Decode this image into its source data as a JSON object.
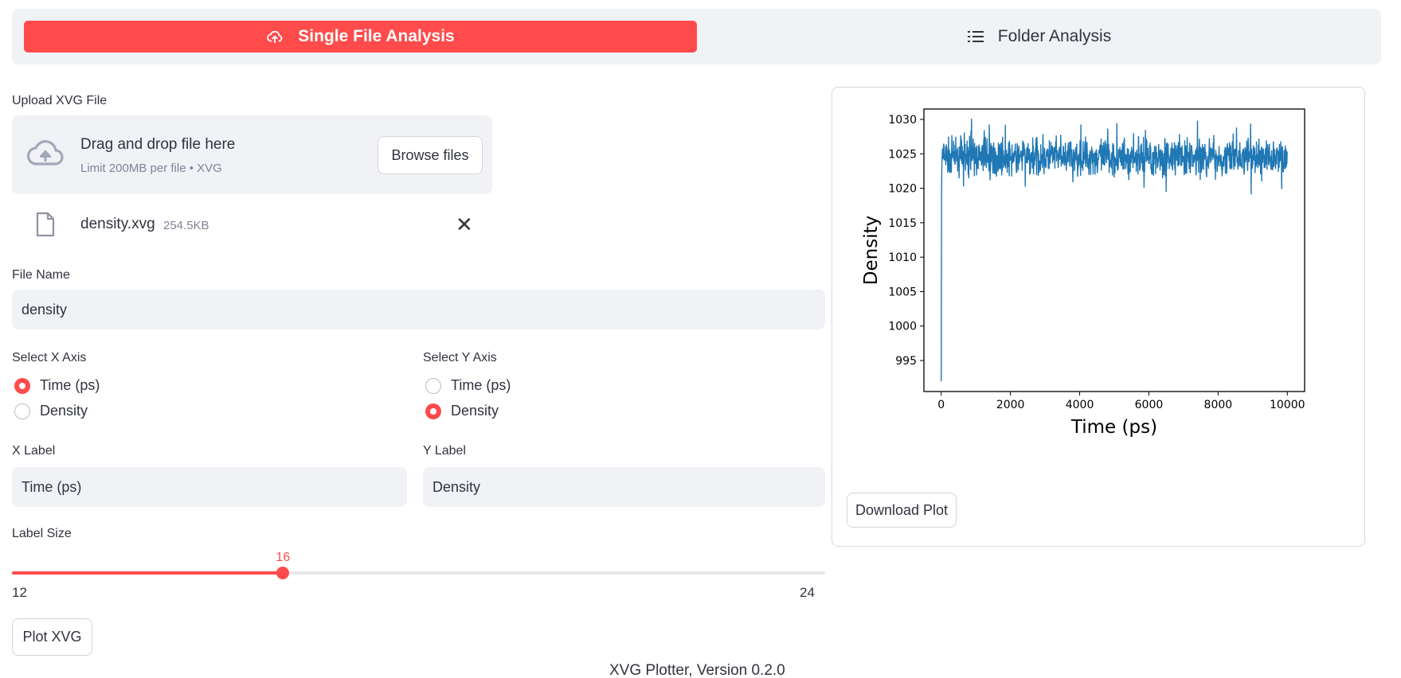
{
  "tabs": {
    "single": {
      "label": "Single File Analysis",
      "icon": "cloud-upload-icon",
      "active": true
    },
    "folder": {
      "label": "Folder Analysis",
      "icon": "list-icon",
      "active": false
    }
  },
  "upload": {
    "label": "Upload XVG File",
    "drag_text": "Drag and drop file here",
    "limit_text": "Limit 200MB per file • XVG",
    "browse_label": "Browse files",
    "file": {
      "name": "density.xvg",
      "size": "254.5KB"
    }
  },
  "file_name": {
    "label": "File Name",
    "value": "density"
  },
  "x_axis": {
    "label": "Select X Axis",
    "options": [
      "Time (ps)",
      "Density"
    ],
    "selected": "Time (ps)"
  },
  "y_axis": {
    "label": "Select Y Axis",
    "options": [
      "Time (ps)",
      "Density"
    ],
    "selected": "Density"
  },
  "x_label": {
    "label": "X Label",
    "value": "Time (ps)"
  },
  "y_label": {
    "label": "Y Label",
    "value": "Density"
  },
  "label_size": {
    "label": "Label Size",
    "value": 16,
    "min": 12,
    "max": 24,
    "value_text": "16",
    "min_text": "12",
    "max_text": "24"
  },
  "buttons": {
    "plot": "Plot XVG",
    "download": "Download Plot"
  },
  "footer": {
    "text": "XVG Plotter, Version 0.2.0"
  },
  "colors": {
    "accent": "#ff4b4b",
    "panel_bg": "#f0f2f6",
    "series": "#1f77b4"
  },
  "chart_data": {
    "type": "line",
    "title": "",
    "xlabel": "Time (ps)",
    "ylabel": "Density",
    "xlim": [
      -500,
      10500
    ],
    "ylim": [
      990.5,
      1031.5
    ],
    "xticks": [
      0,
      2000,
      4000,
      6000,
      8000,
      10000
    ],
    "yticks": [
      995,
      1000,
      1005,
      1010,
      1015,
      1020,
      1025,
      1030
    ],
    "series": [
      {
        "x": [
          0,
          10,
          50,
          100,
          200,
          300,
          400,
          500,
          600,
          700,
          800,
          900,
          1000,
          1500,
          2000,
          2500,
          3000,
          3500,
          4000,
          4500,
          5000,
          5500,
          6000,
          6500,
          7000,
          7200,
          7500,
          8000,
          8500,
          9000,
          9500,
          10000
        ],
        "y": [
          992.0,
          1019.5,
          1025.0,
          1024.5,
          1024.0,
          1024.5,
          1024.2,
          1024.5,
          1024.3,
          1024.6,
          1024.4,
          1024.5,
          1024.5,
          1024.4,
          1024.6,
          1024.5,
          1024.7,
          1024.4,
          1024.5,
          1024.6,
          1024.2,
          1024.5,
          1024.6,
          1024.4,
          1024.5,
          1024.8,
          1024.5,
          1024.4,
          1024.6,
          1024.5,
          1024.4,
          1024.5
        ],
        "noise_range": [
          1019.5,
          1029.5
        ]
      }
    ],
    "grid": false
  }
}
